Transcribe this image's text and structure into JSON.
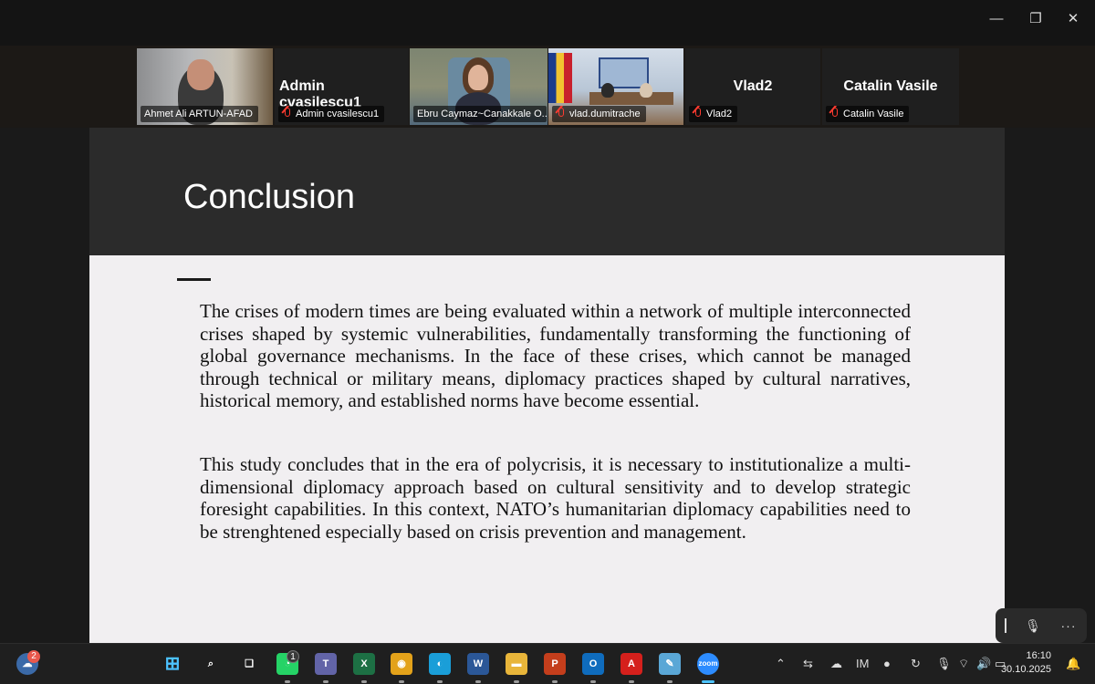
{
  "window": {
    "minimize_glyph": "—",
    "maximize_glyph": "❐",
    "close_glyph": "✕"
  },
  "participants": [
    {
      "tag": "Ahmet Ali ARTUN-AFAD",
      "big_name": "",
      "muted": false,
      "video": true
    },
    {
      "tag": "Admin cvasilescu1",
      "big_name": "Admin cvasilescu1",
      "muted": true,
      "video": false
    },
    {
      "tag": "Ebru Caymaz~Canakkale O...",
      "big_name": "",
      "muted": false,
      "video": true,
      "active": true
    },
    {
      "tag": "vlad.dumitrache",
      "big_name": "",
      "muted": true,
      "video": true
    },
    {
      "tag": "Vlad2",
      "big_name": "Vlad2",
      "muted": true,
      "video": false
    },
    {
      "tag": "Catalin Vasile",
      "big_name": "Catalin Vasile",
      "muted": true,
      "video": false
    }
  ],
  "slide": {
    "title": "Conclusion",
    "paragraph1": "The crises of modern times are being evaluated within a network of multiple interconnected crises shaped by systemic vulnerabilities, fundamentally transforming the functioning of global governance mechanisms. In the face of these crises, which cannot be managed through technical or military means, diplomacy practices shaped by cultural narratives, historical memory, and established norms have become essential.",
    "paragraph2": "This study concludes that in the era of polycrisis, it is necessary to institutionalize a multi-dimensional diplomacy approach based on cultural sensitivity and to develop strategic foresight capabilities. In this context, NATO’s humanitarian diplomacy capabilities need to be strenghtened especially based on crisis prevention and management."
  },
  "taskbar": {
    "widgets_badge": "2",
    "whatsapp_badge": "1",
    "apps": [
      {
        "name": "start-icon",
        "glyph": "⊞",
        "color": "#4cc2ff"
      },
      {
        "name": "search-icon",
        "glyph": "⌕",
        "color": "#ffffff"
      },
      {
        "name": "task-view-icon",
        "glyph": "❏",
        "color": "#ffffff"
      },
      {
        "name": "whatsapp-icon",
        "glyph": "◔",
        "color": "#25d366"
      },
      {
        "name": "teams-icon",
        "glyph": "T",
        "color": "#6264a7"
      },
      {
        "name": "excel-icon",
        "glyph": "X",
        "color": "#1d7044"
      },
      {
        "name": "chrome-icon",
        "glyph": "◉",
        "color": "#e3a21a"
      },
      {
        "name": "edge-icon",
        "glyph": "◐",
        "color": "#1a9ed8"
      },
      {
        "name": "word-icon",
        "glyph": "W",
        "color": "#2b5797"
      },
      {
        "name": "file-explorer-icon",
        "glyph": "▬",
        "color": "#e8b53a"
      },
      {
        "name": "powerpoint-icon",
        "glyph": "P",
        "color": "#c43e1c"
      },
      {
        "name": "outlook-icon",
        "glyph": "O",
        "color": "#0f6cbd"
      },
      {
        "name": "acrobat-icon",
        "glyph": "A",
        "color": "#d5201c"
      },
      {
        "name": "paint-icon",
        "glyph": "✎",
        "color": "#5aa7d6"
      },
      {
        "name": "zoom-icon",
        "glyph": "zoom",
        "color": "#2d8cff"
      }
    ],
    "clock_time": "16:10",
    "clock_date": "30.10.2025"
  }
}
